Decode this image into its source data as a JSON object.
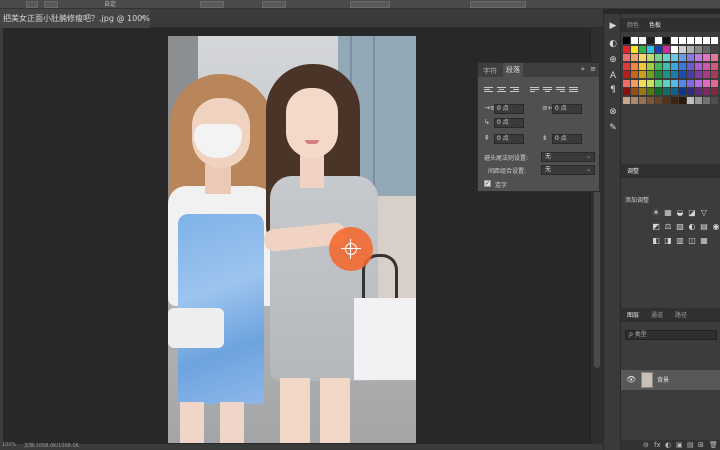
{
  "document": {
    "tab_title": "把美女正面小肚腩修瘦吧？.jpg @ 100%(RGB/8)",
    "close_glyph": "×",
    "zoom_label": "100%",
    "status_info": "文档:1008.0K/1008.0K"
  },
  "options_bar": {
    "items": [
      "自定"
    ]
  },
  "paragraph_panel": {
    "tabs": [
      "字符",
      "段落"
    ],
    "active_tab": "段落",
    "menu_glyph": "»",
    "close_glyph": "≡",
    "fields": [
      {
        "icon": "→≡",
        "value": "0 点"
      },
      {
        "icon": "≡←",
        "value": "0 点"
      },
      {
        "icon": "↳",
        "value": "0 点"
      },
      {
        "icon": "⇞",
        "value": "0 点"
      },
      {
        "icon": "⇟",
        "value": "0 点"
      }
    ],
    "kinsoku_label": "避头尾法则设置:",
    "kinsoku_value": "无",
    "mojikumi_label": "间距组合设置:",
    "mojikumi_value": "无",
    "hyphenate_label": "连字",
    "hyphenate_checked": true,
    "check_glyph": "✓",
    "select_arrow": "⌄"
  },
  "color_panel": {
    "tabs": [
      "颜色",
      "色板"
    ],
    "active_tab": "色板",
    "swatch_rows": [
      [
        "#000000",
        "#ffffff",
        "#f4f4f4",
        "#222222",
        "#ffffff",
        "#111111",
        "#ffffff",
        "#ffffff",
        "#ffffff",
        "#ffffff",
        "#ffffff",
        "#ffffff"
      ],
      [
        "#e8202a",
        "#f6ea1f",
        "#2fb34a",
        "#2cc3e8",
        "#1d3fb0",
        "#d22aa0",
        "#ffffff",
        "#d0d0d0",
        "#b0b0b0",
        "#8a8a8a",
        "#666666",
        "#444444"
      ],
      [
        "#e86f6f",
        "#f1a36b",
        "#f6d86b",
        "#b9dd6b",
        "#78d08a",
        "#6bd6c8",
        "#6bc6e8",
        "#6b9ae8",
        "#8a78e0",
        "#c478e0",
        "#e078c4",
        "#e0789a"
      ],
      [
        "#e23a3a",
        "#ef8a3a",
        "#f0c83a",
        "#9ccf3a",
        "#3ab85a",
        "#3ac0ae",
        "#3aa8dc",
        "#3a78dc",
        "#6a5ad0",
        "#ae5ad0",
        "#d05aae",
        "#d05a7a"
      ],
      [
        "#b81c1c",
        "#c8661c",
        "#c8a01c",
        "#6ea41c",
        "#1c8a3a",
        "#1c9484",
        "#1c7eb0",
        "#1c4cb0",
        "#4a3ca4",
        "#843ca4",
        "#a43c84",
        "#a43c58"
      ],
      [
        "#f26a6a",
        "#f49c5a",
        "#f7dc5a",
        "#c6e45a",
        "#5ad47a",
        "#5ad6c6",
        "#5ab8ea",
        "#5a86ea",
        "#7e6ae2",
        "#ba6ae2",
        "#e26ac0",
        "#e26a92"
      ],
      [
        "#8a1010",
        "#9a4c10",
        "#9a7a10",
        "#4e7a10",
        "#106a28",
        "#106e62",
        "#10608a",
        "#10348a",
        "#34287e",
        "#64287e",
        "#7e2864",
        "#7e2840"
      ],
      [
        "#c8a88a",
        "#b08a6a",
        "#98704e",
        "#7e5836",
        "#674428",
        "#52341c",
        "#3e2412",
        "#2a180a",
        "#c0c0c0",
        "#9a9a9a",
        "#747474",
        "#4e4e4e"
      ]
    ]
  },
  "adjustments_panel": {
    "tab": "调整",
    "heading": "添加调整",
    "rows": [
      [
        "☀",
        "▦",
        "◒",
        "◪",
        "▽"
      ],
      [
        "◩",
        "⚖",
        "▨",
        "◐",
        "▤",
        "◉"
      ],
      [
        "◧",
        "◨",
        "▥",
        "◫",
        "▦"
      ]
    ]
  },
  "layers_panel": {
    "tabs": [
      "图层",
      "通道",
      "路径"
    ],
    "active_tab": "图层",
    "kind_filter": "ρ 类型",
    "layer_name": "背景",
    "eye_glyph": "👁",
    "bottom_buttons": [
      "⊝",
      "fx",
      "◐",
      "▣",
      "▤",
      "⊞",
      "🗑"
    ]
  },
  "tool_strip": {
    "icons": [
      "▶",
      "◐",
      "⊕",
      "A",
      "¶",
      "⊗",
      "✎"
    ]
  }
}
